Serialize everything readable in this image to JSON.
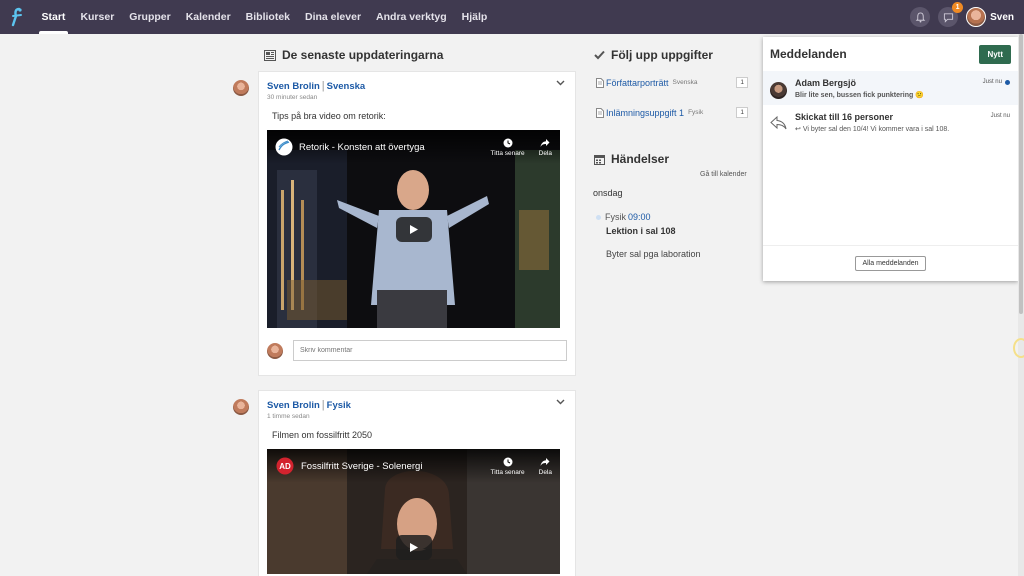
{
  "nav": {
    "items": [
      {
        "label": "Start",
        "active": true
      },
      {
        "label": "Kurser"
      },
      {
        "label": "Grupper"
      },
      {
        "label": "Kalender"
      },
      {
        "label": "Bibliotek"
      },
      {
        "label": "Dina elever"
      },
      {
        "label": "Andra verktyg"
      },
      {
        "label": "Hjälp"
      }
    ],
    "notification_count": "1",
    "user_name": "Sven"
  },
  "feed": {
    "title": "De senaste uppdateringarna",
    "posts": [
      {
        "author": "Sven Brolin",
        "course": "Svenska",
        "time": "30 minuter sedan",
        "text": "Tips på bra video om retorik:",
        "video_title": "Retorik - Konsten att övertyga",
        "watch_later": "Titta senare",
        "share": "Dela",
        "comment_placeholder": "Skriv kommentar"
      },
      {
        "author": "Sven Brolin",
        "course": "Fysik",
        "time": "1 timme sedan",
        "text": "Filmen om fossilfritt 2050",
        "video_title": "Fossilfritt Sverige - Solenergi",
        "watch_later": "Titta senare",
        "share": "Dela",
        "channel_logo": "AD"
      }
    ]
  },
  "tasks": {
    "title": "Följ upp uppgifter",
    "items": [
      {
        "name": "Författarporträtt",
        "course": "Svenska",
        "count": "1"
      },
      {
        "name": "Inlämningsuppgift 1",
        "course": "Fysik",
        "count": "1"
      }
    ]
  },
  "events": {
    "title": "Händelser",
    "goto_calendar": "Gå till kalender",
    "weekday": "onsdag",
    "items": [
      {
        "subject": "Fysik",
        "time": "09:00",
        "title": "Lektion i sal 108",
        "note": "Byter sal pga laboration"
      }
    ]
  },
  "messages": {
    "title": "Meddelanden",
    "new_label": "Nytt",
    "items": [
      {
        "from": "Adam Bergsjö",
        "preview": "Blir lite sen, bussen fick punktering 😕",
        "time": "Just nu",
        "unread": true
      },
      {
        "from": "Skickat till 16 personer",
        "preview": "Vi byter sal den 10/4! Vi kommer vara i sal 108.",
        "time": "Just nu",
        "unread": false
      }
    ],
    "all_label": "Alla meddelanden"
  },
  "colors": {
    "topbar": "#403a50",
    "link": "#1d5aa6",
    "new_button": "#2f6b4f",
    "badge": "#f08a24"
  }
}
